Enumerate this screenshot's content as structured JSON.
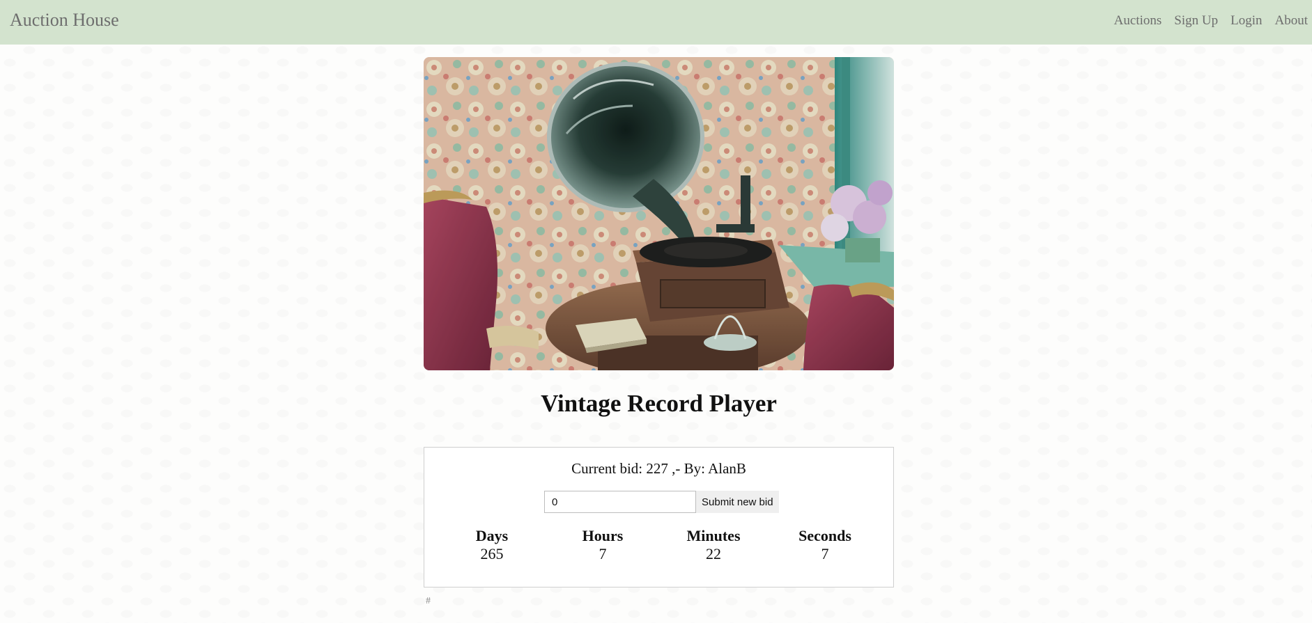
{
  "navbar": {
    "brand": "Auction House",
    "links": [
      "Auctions",
      "Sign Up",
      "Login",
      "About"
    ],
    "background": "#d3e3ce"
  },
  "item": {
    "image_alt": "Vintage gramophone record player",
    "title": "Vintage Record Player"
  },
  "bid": {
    "current_bid_text": "Current bid: 227 ,- By: AlanB",
    "input_value": "0",
    "submit_label": "Submit new bid"
  },
  "countdown": {
    "days_label": "Days",
    "days_value": "265",
    "hours_label": "Hours",
    "hours_value": "7",
    "minutes_label": "Minutes",
    "minutes_value": "22",
    "seconds_label": "Seconds",
    "seconds_value": "7"
  },
  "footer": {
    "hash_link": "#"
  }
}
